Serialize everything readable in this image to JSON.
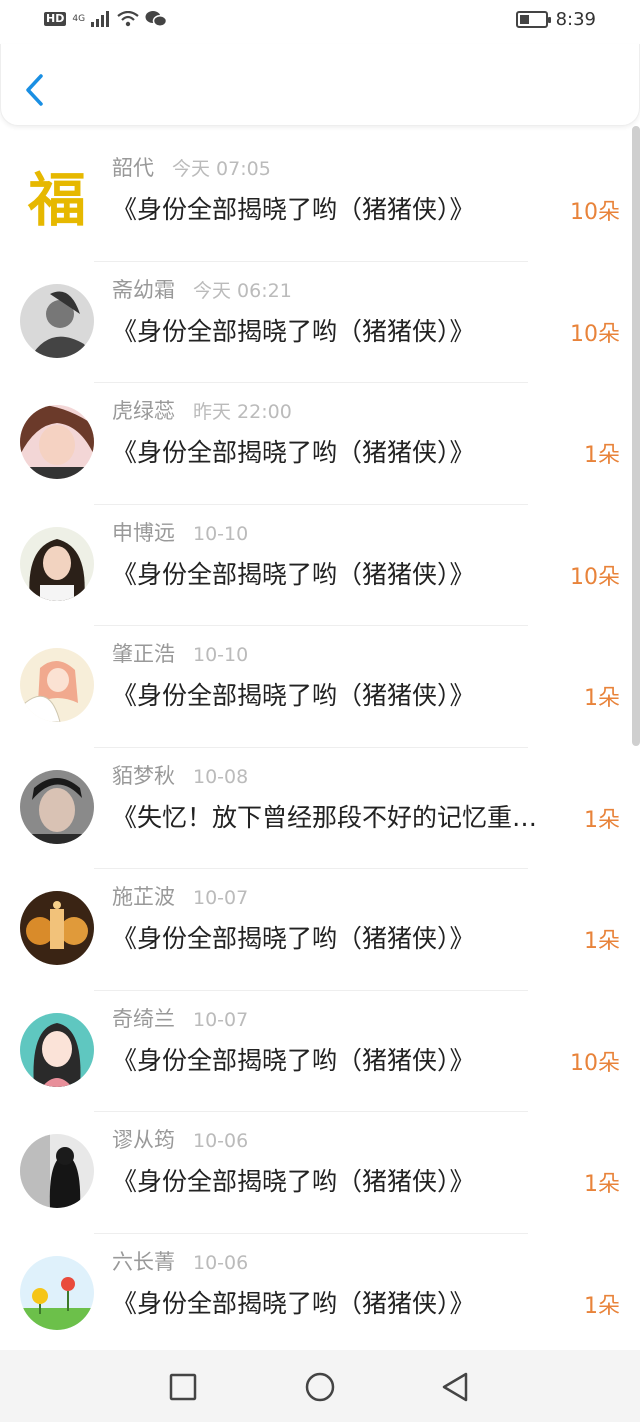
{
  "status": {
    "hd": "HD",
    "network": "4G",
    "time": "8:39"
  },
  "list": [
    {
      "name": "韶代",
      "time": "今天 07:05",
      "title": "《身份全部揭晓了哟（猪猪侠）》",
      "flowers": "10朵"
    },
    {
      "name": "斋幼霜",
      "time": "今天 06:21",
      "title": "《身份全部揭晓了哟（猪猪侠）》",
      "flowers": "10朵"
    },
    {
      "name": "虎绿蕊",
      "time": "昨天 22:00",
      "title": "《身份全部揭晓了哟（猪猪侠）》",
      "flowers": "1朵"
    },
    {
      "name": "申博远",
      "time": "10-10",
      "title": "《身份全部揭晓了哟（猪猪侠）》",
      "flowers": "10朵"
    },
    {
      "name": "肇正浩",
      "time": "10-10",
      "title": "《身份全部揭晓了哟（猪猪侠）》",
      "flowers": "1朵"
    },
    {
      "name": "貊梦秋",
      "time": "10-08",
      "title": "《失忆！放下曾经那段不好的记忆重…",
      "flowers": "1朵"
    },
    {
      "name": "施芷波",
      "time": "10-07",
      "title": "《身份全部揭晓了哟（猪猪侠）》",
      "flowers": "1朵"
    },
    {
      "name": "奇绮兰",
      "time": "10-07",
      "title": "《身份全部揭晓了哟（猪猪侠）》",
      "flowers": "10朵"
    },
    {
      "name": "谬从筠",
      "time": "10-06",
      "title": "《身份全部揭晓了哟（猪猪侠）》",
      "flowers": "1朵"
    },
    {
      "name": "六长菁",
      "time": "10-06",
      "title": "《身份全部揭晓了哟（猪猪侠）》",
      "flowers": "1朵"
    }
  ],
  "colors": {
    "accent": "#1a8fe3",
    "flowers": "#e8833a"
  }
}
